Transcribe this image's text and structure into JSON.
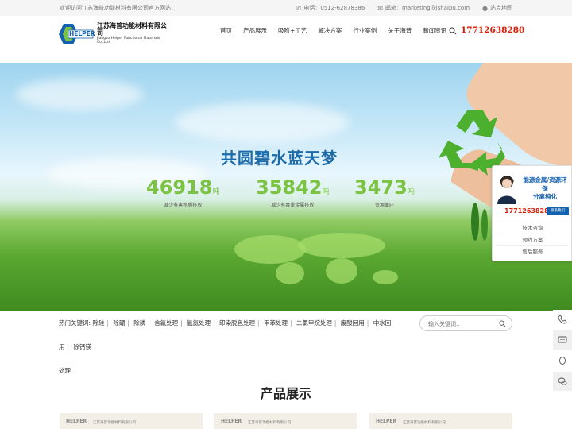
{
  "topbar": {
    "welcome": "欢迎访问江苏海普功能材料有限公司官方网站!",
    "phone": "电话：0512-62878386",
    "email": "邮箱：marketing@jshaipu.com",
    "sitemap": "站点地图"
  },
  "logo": {
    "mark": "HELPER",
    "cn": "江苏海普功能材料有限公司",
    "en": "Jiangsu Helper Functional Materials Co.,Ltd."
  },
  "nav": [
    "首页",
    "产品展示",
    "吸附+工艺",
    "解决方案",
    "行业案例",
    "关于海普",
    "新闻资讯"
  ],
  "hotline": "17712638280",
  "banner": {
    "slogan": "共圆碧水蓝天梦",
    "stats": [
      {
        "num": "46918",
        "unit": "吨",
        "caption": "减少有害物质排放"
      },
      {
        "num": "35842",
        "unit": "吨",
        "caption": "减少有毒重金属排放"
      },
      {
        "num": "3473",
        "unit": "吨",
        "caption": "资源循环"
      }
    ]
  },
  "service": {
    "title_line1": "能源金属/资源环保",
    "title_line2": "分离纯化",
    "phone": "17712638280",
    "contact_btn": "联系我们",
    "links": [
      "技术咨询",
      "预约方案",
      "售后服务"
    ]
  },
  "keywords": {
    "label": "热门关键词:",
    "items": [
      "除硅",
      "除硼",
      "除磷",
      "含氟处理",
      "氨氮处理",
      "印染脱色处理",
      "甲苯处理",
      "二氯甲烷处理",
      "废酸回用",
      "中水回用",
      "除钙镁",
      "处理"
    ]
  },
  "search": {
    "placeholder": "输入关键词.."
  },
  "products": {
    "title": "产品展示",
    "card_logo": "HELPER",
    "card_name": "江苏海普功能材料有限公司"
  },
  "colors": {
    "brand_blue": "#1461b0",
    "accent_red": "#d81e06",
    "stat_green": "#7cc243"
  }
}
